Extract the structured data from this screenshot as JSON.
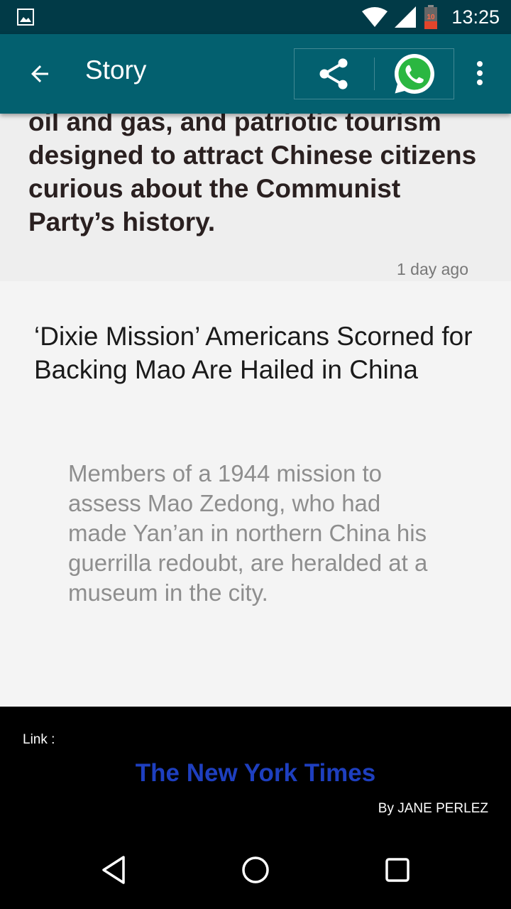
{
  "status_bar": {
    "time": "13:25",
    "battery_level": "10",
    "icons": [
      "gallery-notification-icon",
      "wifi-icon",
      "cellular-signal-icon",
      "battery-icon"
    ]
  },
  "app_bar": {
    "title": "Story",
    "icons": [
      "back-arrow-icon",
      "share-icon",
      "whatsapp-icon",
      "more-vert-icon"
    ],
    "colors": {
      "status_bar": "#013a47",
      "app_bar": "#03606f"
    }
  },
  "previous_story": {
    "text": "oil and gas, and patriotic tourism designed to attract Chinese citizens curious about the Communist Party’s history.",
    "time_ago": "1 day ago"
  },
  "story": {
    "title": "‘Dixie Mission’ Americans Scorned for Backing Mao Are Hailed in China",
    "summary": "Members of a 1944 mission to assess Mao Zedong, who had made Yan’an in northern China his guerrilla redoubt, are heralded at a museum in the city."
  },
  "footer": {
    "link_label": "Link :",
    "source": "The New York Times",
    "byline": "By JANE PERLEZ",
    "link_color": "#1e3fbf"
  },
  "nav_bar": {
    "icons": [
      "back-triangle-icon",
      "home-circle-icon",
      "recents-square-icon"
    ]
  }
}
